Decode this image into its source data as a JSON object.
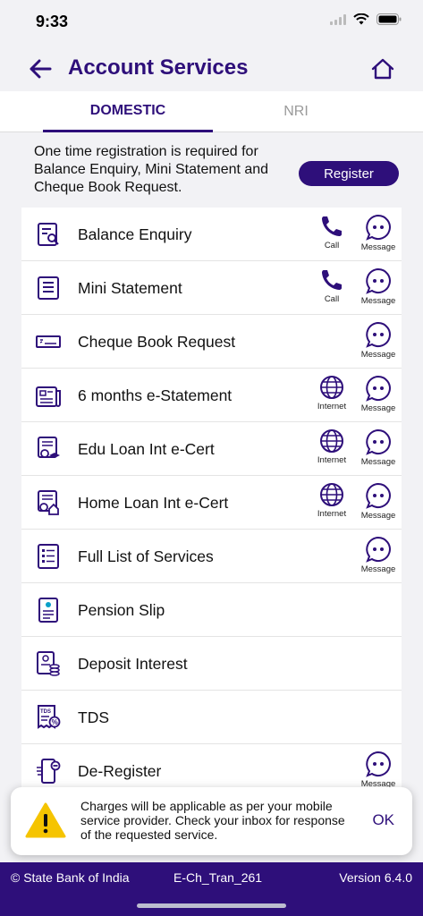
{
  "status_bar": {
    "time": "9:33"
  },
  "header": {
    "title": "Account Services",
    "back_icon": "back-arrow-icon",
    "home_icon": "home-icon"
  },
  "tabs": [
    {
      "label": "DOMESTIC",
      "active": true
    },
    {
      "label": "NRI",
      "active": false
    }
  ],
  "registration": {
    "text": "One time registration is required for Balance Enquiry, Mini Statement and Cheque Book Request.",
    "button_label": "Register"
  },
  "services": [
    {
      "label": "Balance Enquiry",
      "icon": "balance-enquiry-icon",
      "actions": [
        {
          "type": "call",
          "label": "Call"
        },
        {
          "type": "message",
          "label": "Message"
        }
      ]
    },
    {
      "label": "Mini Statement",
      "icon": "mini-statement-icon",
      "actions": [
        {
          "type": "call",
          "label": "Call"
        },
        {
          "type": "message",
          "label": "Message"
        }
      ]
    },
    {
      "label": "Cheque Book Request",
      "icon": "cheque-book-icon",
      "actions": [
        {
          "type": "message",
          "label": "Message"
        }
      ]
    },
    {
      "label": "6 months e-Statement",
      "icon": "e-statement-icon",
      "actions": [
        {
          "type": "internet",
          "label": "Internet"
        },
        {
          "type": "message",
          "label": "Message"
        }
      ]
    },
    {
      "label": "Edu Loan Int e-Cert",
      "icon": "edu-loan-certificate-icon",
      "actions": [
        {
          "type": "internet",
          "label": "Internet"
        },
        {
          "type": "message",
          "label": "Message"
        }
      ]
    },
    {
      "label": "Home Loan Int e-Cert",
      "icon": "home-loan-certificate-icon",
      "actions": [
        {
          "type": "internet",
          "label": "Internet"
        },
        {
          "type": "message",
          "label": "Message"
        }
      ]
    },
    {
      "label": "Full List of Services",
      "icon": "full-list-icon",
      "actions": [
        {
          "type": "message",
          "label": "Message"
        }
      ]
    },
    {
      "label": "Pension Slip",
      "icon": "pension-slip-icon",
      "actions": []
    },
    {
      "label": "Deposit Interest",
      "icon": "deposit-interest-icon",
      "actions": []
    },
    {
      "label": "TDS",
      "icon": "tds-icon",
      "actions": []
    },
    {
      "label": "De-Register",
      "icon": "de-register-icon",
      "actions": [
        {
          "type": "message",
          "label": "Message"
        }
      ]
    }
  ],
  "toast": {
    "icon": "warning-icon",
    "text": "Charges will be applicable as per your mobile service provider. Check your inbox for response of the requested service.",
    "ok_label": "OK"
  },
  "footer": {
    "copyright": "© State Bank of India",
    "code": "E-Ch_Tran_261",
    "version": "Version 6.4.0"
  },
  "colors": {
    "brand": "#2e0f7a",
    "warning": "#f5c400"
  }
}
